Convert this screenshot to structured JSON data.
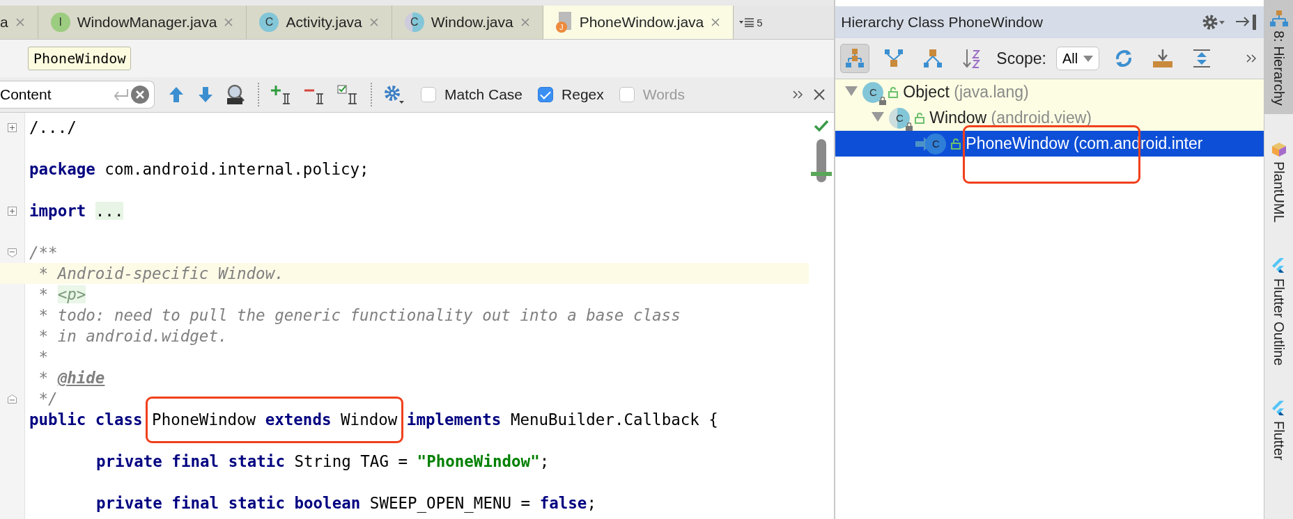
{
  "editor_tabs": [
    {
      "label": "a",
      "selected": false
    },
    {
      "label": "WindowManager.java",
      "icon": {
        "kind": "interface",
        "letter": "I"
      },
      "selected": false
    },
    {
      "label": "Activity.java",
      "icon": {
        "kind": "class",
        "letter": "C"
      },
      "selected": false
    },
    {
      "label": "Window.java",
      "icon": {
        "kind": "abstract",
        "letter": "C"
      },
      "selected": false
    },
    {
      "label": "PhoneWindow.java",
      "icon": {
        "kind": "java_file",
        "letter": "J"
      },
      "selected": true
    }
  ],
  "tab_overflow": {
    "count": "5"
  },
  "breadcrumb": "PhoneWindow",
  "find_bar": {
    "query": "Content",
    "options": [
      {
        "label": "Match Case",
        "checked": false,
        "disabled": false
      },
      {
        "label": "Regex",
        "checked": true,
        "disabled": false
      },
      {
        "label": "Words",
        "checked": false,
        "disabled": true
      }
    ]
  },
  "code_lines": [
    {
      "collapsed": true,
      "tokens": [
        {
          "kind": "plain",
          "text": "/.../"
        }
      ]
    },
    {
      "space_before": true,
      "tokens": [
        {
          "kind": "keyword",
          "text": "package"
        },
        {
          "kind": "plain",
          "text": " com.android.internal.policy;"
        }
      ]
    },
    {
      "space_before": true,
      "collapsed": true,
      "tokens": [
        {
          "kind": "keyword",
          "text": "import "
        },
        {
          "kind": "folded",
          "text": "..."
        }
      ]
    },
    {
      "space_before": true,
      "fold_start": true,
      "tokens": [
        {
          "kind": "comment",
          "text": "/**"
        }
      ]
    },
    {
      "current": true,
      "tokens": [
        {
          "kind": "comment",
          "text": " * Android-specific Window."
        }
      ]
    },
    {
      "tokens": [
        {
          "kind": "comment",
          "text": " * "
        },
        {
          "kind": "html_tag",
          "text": "<p>"
        }
      ]
    },
    {
      "tokens": [
        {
          "kind": "comment",
          "text": " * todo: need to pull the generic functionality out into a base class"
        }
      ]
    },
    {
      "tokens": [
        {
          "kind": "comment",
          "text": " * in android.widget."
        }
      ]
    },
    {
      "tokens": [
        {
          "kind": "comment",
          "text": " *"
        }
      ]
    },
    {
      "tokens": [
        {
          "kind": "comment",
          "text": " * "
        },
        {
          "kind": "doc_tag",
          "text": "@hide"
        }
      ]
    },
    {
      "fold_end": true,
      "tokens": [
        {
          "kind": "comment",
          "text": " */"
        }
      ]
    },
    {
      "tokens": [
        {
          "kind": "keyword",
          "text": "public class "
        },
        {
          "kind": "plain",
          "text": "PhoneWindow ",
          "boxed": true
        },
        {
          "kind": "keyword",
          "text": "extends",
          "boxed": true
        },
        {
          "kind": "plain",
          "text": " Window",
          "boxed": true
        },
        {
          "kind": "keyword",
          "text": " implements"
        },
        {
          "kind": "plain",
          "text": " MenuBuilder.Callback {"
        }
      ]
    },
    {
      "space_before": true,
      "indented": true,
      "tokens": [
        {
          "kind": "keyword",
          "text": "private final static"
        },
        {
          "kind": "plain",
          "text": " String TAG = "
        },
        {
          "kind": "string",
          "text": "\"PhoneWindow\""
        },
        {
          "kind": "plain",
          "text": ";"
        }
      ]
    },
    {
      "space_before": true,
      "indented": true,
      "tokens": [
        {
          "kind": "keyword",
          "text": "private final static boolean"
        },
        {
          "kind": "plain",
          "text": " SWEEP_OPEN_MENU = "
        },
        {
          "kind": "keyword",
          "text": "false"
        },
        {
          "kind": "plain",
          "text": ";"
        }
      ]
    }
  ],
  "hierarchy_panel": {
    "title": "Hierarchy Class PhoneWindow",
    "scope_label": "Scope:",
    "scope": "All",
    "tree": [
      {
        "name": "Object",
        "package": "(java.lang)",
        "icon": {
          "kind": "class",
          "letter": "C",
          "locked": true
        },
        "expanded": true,
        "selected": false,
        "library": true,
        "children": [
          {
            "name": "Window",
            "package": "(android.view)",
            "icon": {
              "kind": "abstract",
              "letter": "C",
              "locked": true
            },
            "expanded": true,
            "selected": false,
            "library": true,
            "children": [
              {
                "name": "PhoneWindow",
                "package": "(com.android.inter",
                "icon": {
                  "kind": "current",
                  "letter": "C"
                },
                "selected": true,
                "boxed": true
              }
            ]
          }
        ]
      }
    ]
  },
  "tool_strip": [
    {
      "label": "8: Hierarchy",
      "kind": "hierarchy",
      "selected": true
    },
    {
      "label": "PlantUML",
      "kind": "plantuml",
      "selected": false
    },
    {
      "label": "Flutter Outline",
      "kind": "flutter",
      "selected": false
    },
    {
      "label": "Flutter",
      "kind": "flutter",
      "selected": false
    }
  ]
}
